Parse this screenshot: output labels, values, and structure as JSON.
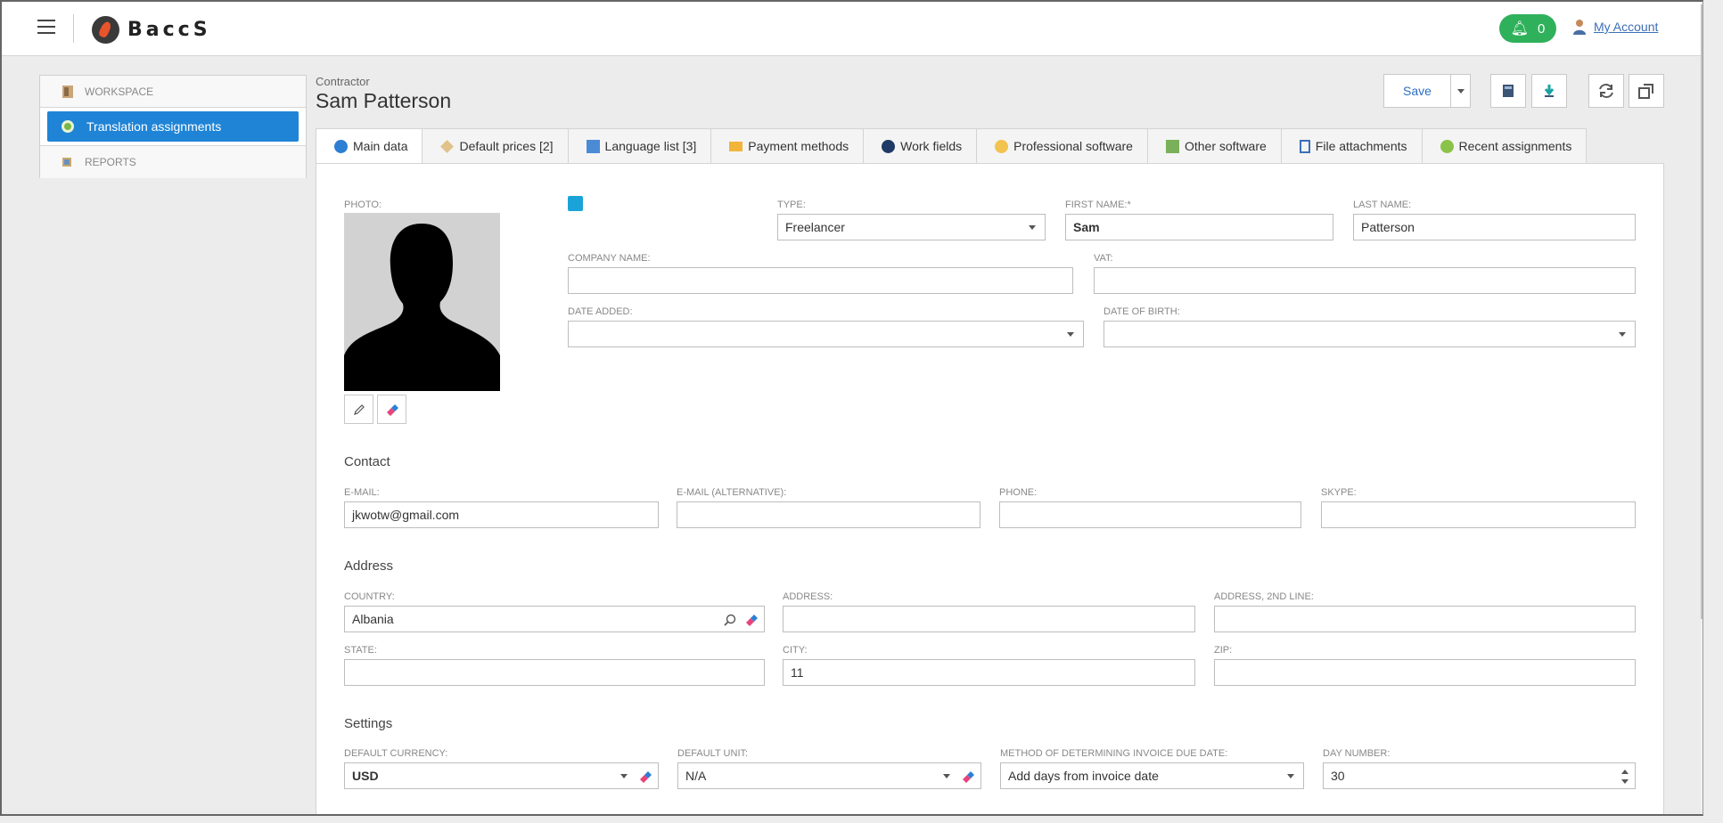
{
  "app": {
    "logo_text": "BaccS"
  },
  "header": {
    "notifications_count": "0",
    "account_label": "My Account"
  },
  "sidebar": {
    "workspace": "WORKSPACE",
    "active_item": "Translation assignments",
    "reports": "REPORTS"
  },
  "page": {
    "subtitle": "Contractor",
    "title": "Sam Patterson",
    "save_label": "Save"
  },
  "tabs": [
    {
      "label": "Main data"
    },
    {
      "label": "Default prices [2]"
    },
    {
      "label": "Language list [3]"
    },
    {
      "label": "Payment methods"
    },
    {
      "label": "Work fields"
    },
    {
      "label": "Professional software"
    },
    {
      "label": "Other software"
    },
    {
      "label": "File attachments"
    },
    {
      "label": "Recent assignments"
    }
  ],
  "form": {
    "photo_label": "PHOTO:",
    "type": {
      "label": "TYPE:",
      "value": "Freelancer"
    },
    "first_name": {
      "label": "FIRST NAME:*",
      "value": "Sam"
    },
    "last_name": {
      "label": "LAST NAME:",
      "value": "Patterson"
    },
    "company_name": {
      "label": "COMPANY NAME:",
      "value": ""
    },
    "vat": {
      "label": "VAT:",
      "value": ""
    },
    "date_added": {
      "label": "DATE ADDED:",
      "value": ""
    },
    "date_of_birth": {
      "label": "DATE OF BIRTH:",
      "value": ""
    },
    "contact": {
      "title": "Contact",
      "email": {
        "label": "E-MAIL:",
        "value": "jkwotw@gmail.com"
      },
      "email_alt": {
        "label": "E-MAIL (ALTERNATIVE):",
        "value": ""
      },
      "phone": {
        "label": "PHONE:",
        "value": ""
      },
      "skype": {
        "label": "SKYPE:",
        "value": ""
      }
    },
    "address": {
      "title": "Address",
      "country": {
        "label": "COUNTRY:",
        "value": "Albania"
      },
      "address1": {
        "label": "ADDRESS:",
        "value": ""
      },
      "address2": {
        "label": "ADDRESS, 2ND LINE:",
        "value": ""
      },
      "state": {
        "label": "STATE:",
        "value": ""
      },
      "city": {
        "label": "CITY:",
        "value": "11"
      },
      "zip": {
        "label": "ZIP:",
        "value": ""
      }
    },
    "settings": {
      "title": "Settings",
      "currency": {
        "label": "DEFAULT CURRENCY:",
        "value": "USD"
      },
      "unit": {
        "label": "DEFAULT UNIT:",
        "value": "N/A"
      },
      "invoice_method": {
        "label": "METHOD OF DETERMINING INVOICE DUE DATE:",
        "value": "Add days from invoice date"
      },
      "day_number": {
        "label": "DAY NUMBER:",
        "value": "30"
      }
    }
  },
  "colors": {
    "accent": "#1f84d6",
    "notif": "#2fb15b",
    "link": "#3d6fb5"
  }
}
